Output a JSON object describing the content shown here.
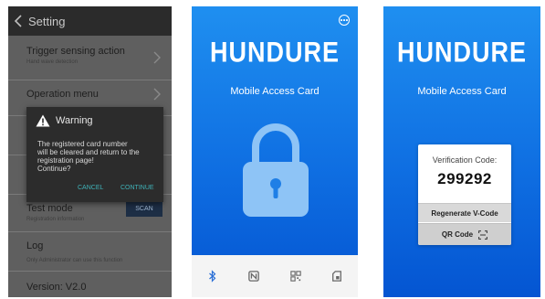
{
  "settings": {
    "header_title": "Setting",
    "rows": [
      {
        "title": "Trigger sensing action",
        "subtitle": "Hand wave detection"
      },
      {
        "title": "Operation menu"
      },
      {
        "title": "Test mode",
        "subtitle": "Registration information"
      },
      {
        "title": "Log",
        "subtitle": "Only Administrator can use this function"
      },
      {
        "title": "Version: V2.0"
      }
    ],
    "scan_label": "SCAN",
    "dialog": {
      "title": "Warning",
      "message_lines": [
        "The registered card number",
        "will be cleared and return to the",
        "registration page!",
        "Continue?"
      ],
      "cancel_label": "CANCEL",
      "continue_label": "CONTINUE"
    }
  },
  "lock_screen": {
    "brand": "HUNDURE",
    "subtitle": "Mobile Access Card",
    "tabs": [
      "bluetooth-icon",
      "nfc-icon",
      "qr-code-icon",
      "card-icon"
    ]
  },
  "vcode_screen": {
    "brand": "HUNDURE",
    "subtitle": "Mobile Access Card",
    "verification_label": "Verification Code:",
    "verification_code": "299292",
    "regenerate_label": "Regenerate V-Code",
    "qr_label": "QR Code"
  },
  "colors": {
    "brand_blue": "#0f6fe2",
    "settings_bg": "#5f5f5f",
    "dialog_bg": "#2c2c2c",
    "dialog_button": "#3fb2b8",
    "scan_button": "#1d2e45"
  }
}
